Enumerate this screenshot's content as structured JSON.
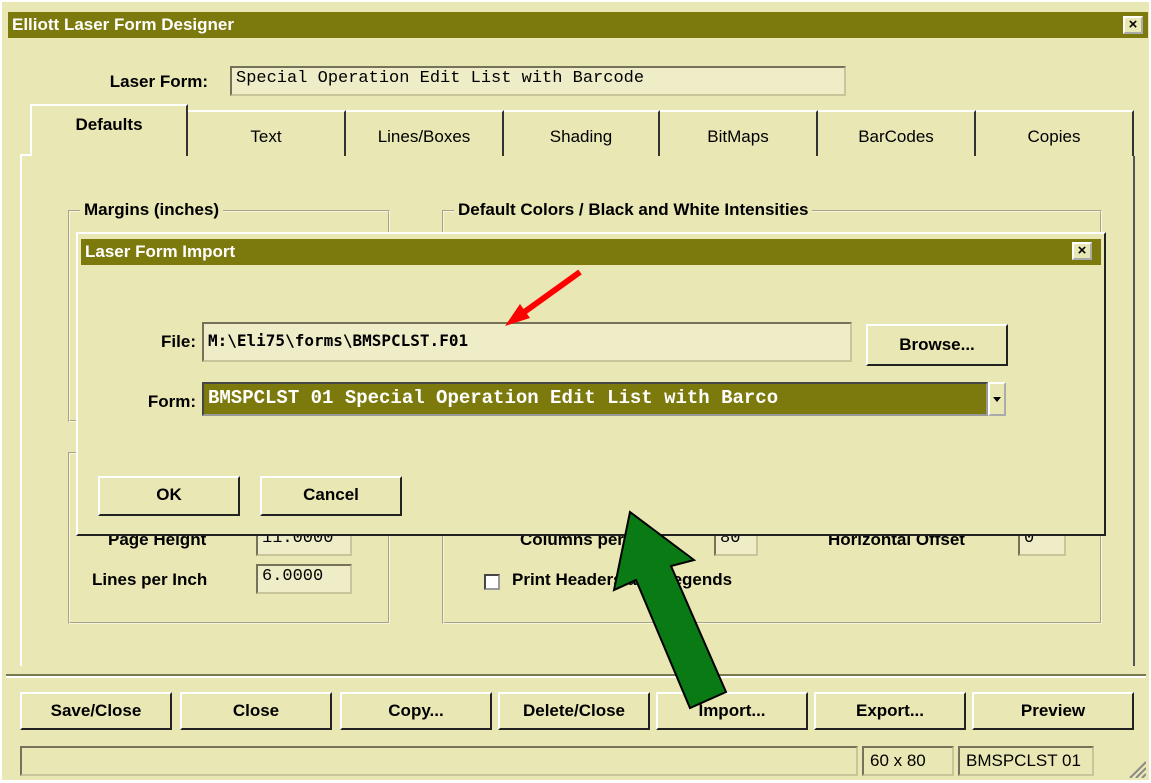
{
  "window": {
    "title": "Elliott Laser Form Designer",
    "close_glyph": "×"
  },
  "laser_form": {
    "label": "Laser Form:",
    "value": "Special Operation Edit List with Barcode"
  },
  "tabs": [
    {
      "label": "Defaults"
    },
    {
      "label": "Text"
    },
    {
      "label": "Lines/Boxes"
    },
    {
      "label": "Shading"
    },
    {
      "label": "BitMaps"
    },
    {
      "label": "BarCodes"
    },
    {
      "label": "Copies"
    }
  ],
  "groups": {
    "margins": "Margins (inches)",
    "colors": "Default Colors / Black and White Intensities"
  },
  "page": {
    "page_height_label": "Page Height",
    "page_height_value": "11.0000",
    "lines_per_inch_label": "Lines per Inch",
    "lines_per_inch_value": "6.0000",
    "columns_label": "Columns per Line",
    "columns_value": "80",
    "horizontal_offset_label": "Horizontal Offset",
    "horizontal_offset_value": "0",
    "print_headers_label": "Print Headers and Legends"
  },
  "buttons": {
    "save_close": "Save/Close",
    "close": "Close",
    "copy": "Copy...",
    "delete_close": "Delete/Close",
    "import": "Import...",
    "export": "Export...",
    "preview": "Preview"
  },
  "status": {
    "dimensions": "60 x 80",
    "form_code": "BMSPCLST 01"
  },
  "dialog": {
    "title": "Laser Form Import",
    "close_glyph": "×",
    "file_label": "File:",
    "file_value": "M:\\Eli75\\forms\\BMSPCLST.F01",
    "browse": "Browse...",
    "form_label": "Form:",
    "form_value": "BMSPCLST  01  Special Operation Edit List with Barco",
    "ok": "OK",
    "cancel": "Cancel"
  },
  "colors": {
    "title_bar": "#7d7a0d",
    "background": "#e9e7b4",
    "red_arrow": "#ff0000",
    "green_arrow": "#0a7a15"
  },
  "icons": {
    "dropdown": "chevron-down-icon",
    "close": "close-icon"
  }
}
